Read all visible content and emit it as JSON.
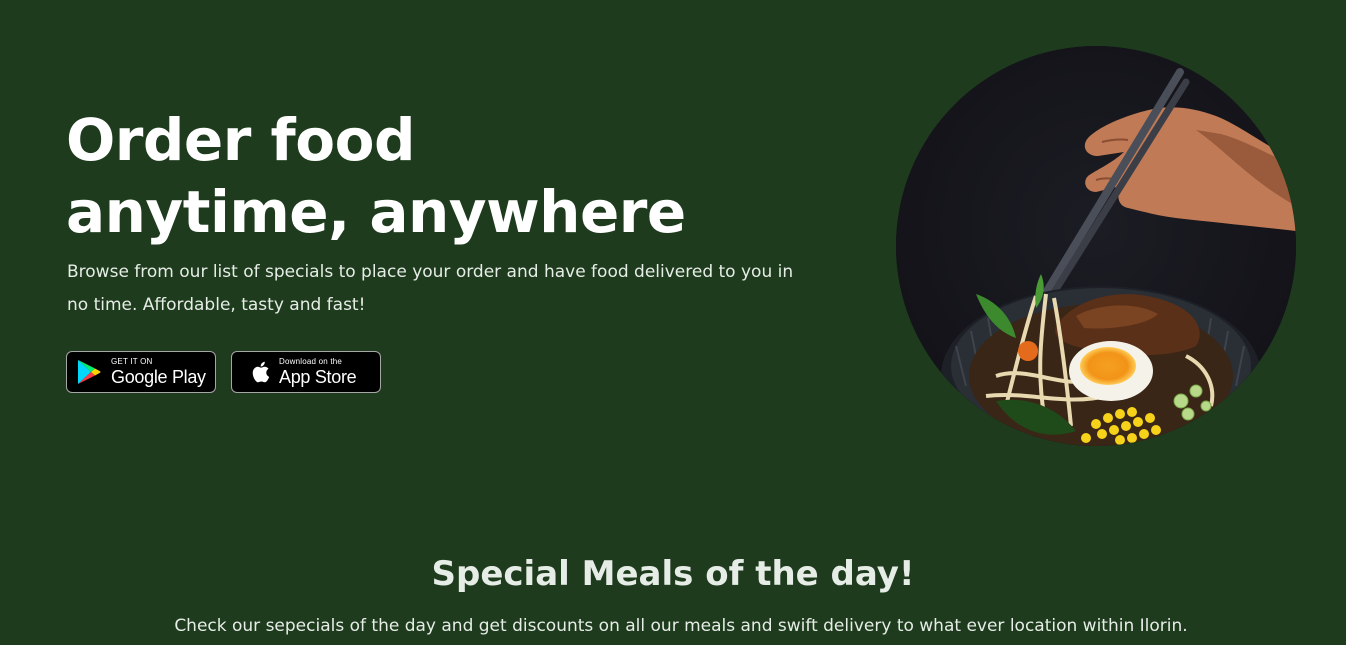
{
  "hero": {
    "title": "Order food anytime, anywhere",
    "description": "Browse from our list of specials to place your order and have food delivered to you in no time. Affordable, tasty and fast!",
    "google_play": {
      "small_label": "GET IT ON",
      "label": "Google Play",
      "icon": "google-play-icon"
    },
    "app_store": {
      "small_label": "Download on the",
      "label": "App Store",
      "icon": "apple-icon"
    },
    "image": {
      "subject": "ramen-bowl-with-chopsticks"
    }
  },
  "specials": {
    "title": "Special Meals of the day!",
    "description": "Check our sepecials of the day and get discounts on all our meals and swift delivery to what ever location within Ilorin."
  },
  "colors": {
    "background": "#1e3b1e",
    "text": "#ffffff",
    "muted_text": "#e6ece6",
    "button_background": "#000000",
    "button_border": "#a6a6a6"
  }
}
